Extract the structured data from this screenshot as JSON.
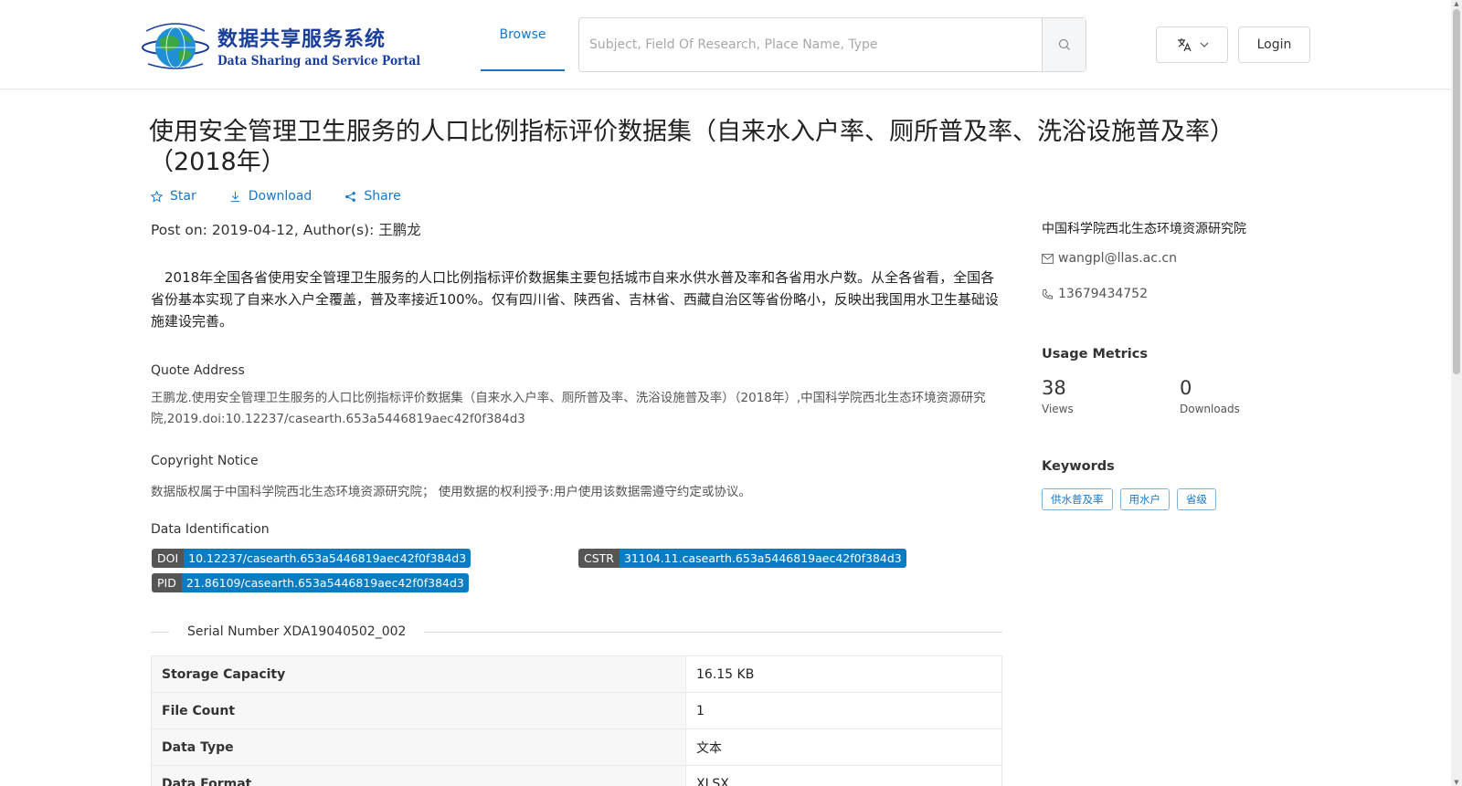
{
  "header": {
    "logo_cn": "数据共享服务系统",
    "logo_en": "Data Sharing and Service Portal",
    "nav_browse": "Browse",
    "search_placeholder": "Subject, Field Of Research, Place Name, Type",
    "login": "Login"
  },
  "dataset": {
    "title": "使用安全管理卫生服务的人口比例指标评价数据集（自来水入户率、厕所普及率、洗浴设施普及率）（2018年）",
    "actions": {
      "star": "Star",
      "download": "Download",
      "share": "Share"
    },
    "meta": "Post on: 2019-04-12, Author(s): 王鹏龙",
    "description": "2018年全国各省使用安全管理卫生服务的人口比例指标评价数据集主要包括城市自来水供水普及率和各省用水户数。从全各省看，全国各省份基本实现了自来水入户全覆盖，普及率接近100%。仅有四川省、陕西省、吉林省、西藏自治区等省份略小，反映出我国用水卫生基础设施建设完善。",
    "quote_label": "Quote Address",
    "quote": "王鹏龙.使用安全管理卫生服务的人口比例指标评价数据集（自来水入户率、厕所普及率、洗浴设施普及率）（2018年）,中国科学院西北生态环境资源研究院,2019.doi:10.12237/casearth.653a5446819aec42f0f384d3",
    "copyright_label": "Copyright Notice",
    "copyright": "数据版权属于中国科学院西北生态环境资源研究院； 使用数据的权利授予:用户使用该数据需遵守约定或协议。",
    "identification_label": "Data Identification",
    "identifiers": {
      "doi_key": "DOI",
      "doi": "10.12237/casearth.653a5446819aec42f0f384d3",
      "cstr_key": "CSTR",
      "cstr": "31104.11.casearth.653a5446819aec42f0f384d3",
      "pid_key": "PID",
      "pid": "21.86109/casearth.653a5446819aec42f0f384d3"
    },
    "serial": "Serial Number XDA19040502_002",
    "table": [
      {
        "key": "Storage Capacity",
        "value": "16.15 KB"
      },
      {
        "key": "File Count",
        "value": "1"
      },
      {
        "key": "Data Type",
        "value": "文本"
      },
      {
        "key": "Data Format",
        "value": "XLSX"
      }
    ]
  },
  "sidebar": {
    "institution": "中国科学院西北生态环境资源研究院",
    "email": "wangpl@llas.ac.cn",
    "phone": "13679434752",
    "usage_title": "Usage Metrics",
    "views": "38",
    "views_label": "Views",
    "downloads": "0",
    "downloads_label": "Downloads",
    "keywords_title": "Keywords",
    "keywords": [
      "供水普及率",
      "用水户",
      "省级"
    ]
  },
  "colors": {
    "accent": "#1677c8",
    "badge_value": "#0a7cc2",
    "badge_key": "#555555",
    "logo": "#1a3f9a"
  }
}
